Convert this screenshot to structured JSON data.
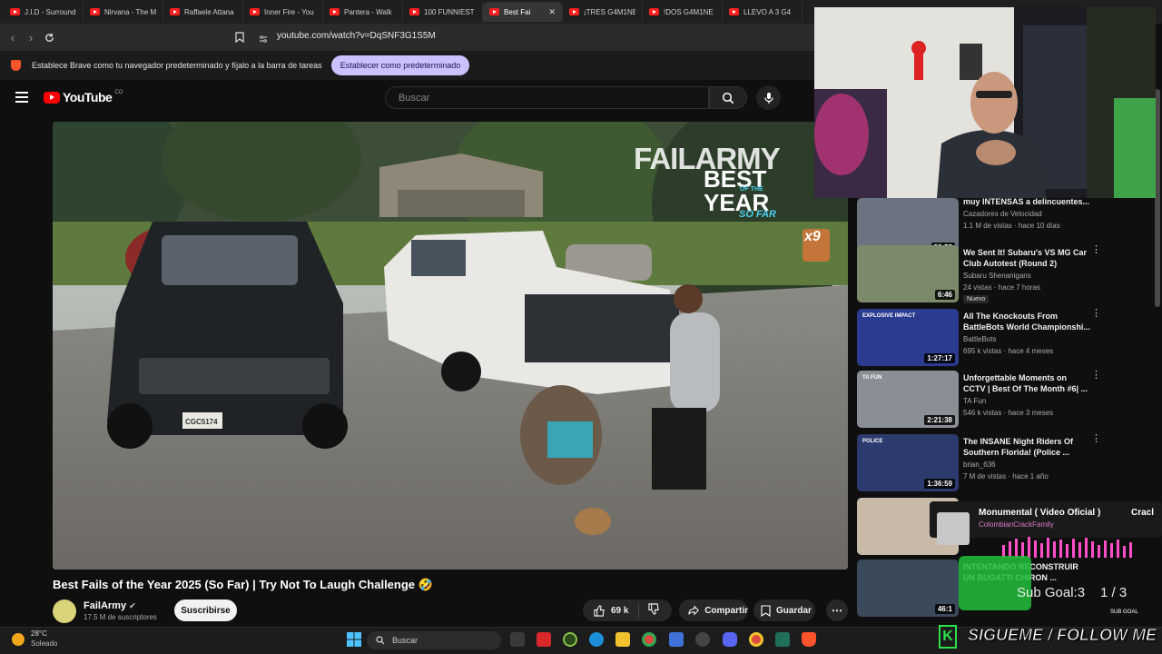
{
  "browser": {
    "tabs": [
      {
        "title": "J.I.D - Surround"
      },
      {
        "title": "Nirvana - The M"
      },
      {
        "title": "Raffaele Attana"
      },
      {
        "title": "Inner Fire - You"
      },
      {
        "title": "Pantera - Walk"
      },
      {
        "title": "100 FUNNIEST"
      },
      {
        "title": "Best Fai",
        "active": true
      },
      {
        "title": "¡TRES G4M1NE"
      },
      {
        "title": "!DOS G4M1NE"
      },
      {
        "title": "LLEVO A 3 G4"
      }
    ],
    "url": "youtube.com/watch?v=DqSNF3G1S5M",
    "banner_text": "Establece Brave como tu navegador predeterminado y fíjalo a la barra de tareas",
    "banner_button": "Establecer como predeterminado"
  },
  "youtube": {
    "logo": "YouTube",
    "country": "CO",
    "search_placeholder": "Buscar",
    "video": {
      "title": "Best Fails of the Year 2025 (So Far) | Try Not To Laugh Challenge 🤣",
      "watermark_brand": "FAILARMY",
      "watermark_best": "BEST",
      "watermark_of": "OF THE",
      "watermark_year": "YEAR",
      "watermark_sofar": "SO FAR",
      "multiplier": "x9",
      "plate": "CGC5174"
    },
    "channel": {
      "name": "FailArmy",
      "subscribers": "17.5 M de suscriptores",
      "subscribe": "Suscribirse"
    },
    "actions": {
      "likes": "69 k",
      "share": "Compartir",
      "save": "Guardar"
    },
    "sidebar": [
      {
        "title": "muy INTENSAS a delincuentes...",
        "channel": "Cazadores de Velocidad",
        "meta": "1.1 M de vistas · hace 10 días",
        "duration": "33:58",
        "thumb_color": "#6b7280"
      },
      {
        "title": "We Sent It! Subaru's VS MG Car Club Autotest (Round 2)",
        "channel": "Subaru Shenanigans",
        "meta": "24 vistas · hace 7 horas",
        "badge": "Nuevo",
        "duration": "6:46",
        "thumb_color": "#7a8a6a"
      },
      {
        "title": "All The Knockouts From BattleBots World Championshi...",
        "channel": "BattleBots",
        "meta": "695 k vistas · hace 4 meses",
        "duration": "1:27:17",
        "thumb_color": "#2b3b8f",
        "thumb_text": "EXPLOSIVE IMPACT"
      },
      {
        "title": "Unforgettable Moments on CCTV | Best Of The Month #6| ...",
        "channel": "TA Fun",
        "meta": "546 k vistas · hace 3 meses",
        "duration": "2:21:38",
        "thumb_color": "#8a8f96",
        "thumb_text": "TA FUN"
      },
      {
        "title": "The INSANE Night Riders Of Southern Florida! (Police ...",
        "channel": "brian_636",
        "meta": "7 M de vistas · hace 1 año",
        "duration": "1:36:59",
        "thumb_color": "#2d3a6e",
        "thumb_text": "POLICE"
      },
      {
        "title": "",
        "channel": "",
        "meta": "",
        "duration": "",
        "thumb_color": "#c9b9a8"
      },
      {
        "title": "INTENTANDO RECONSTRUIR UN BUGATTI CHIRON ...",
        "channel": "",
        "meta": "",
        "duration": "46:1",
        "thumb_color": "#3a4a5a"
      }
    ]
  },
  "overlay": {
    "song": "Monumental ( Video Oficial )",
    "song_extra": "Cracl",
    "artist": "ColombianCrackFamily",
    "sub_goal": "Sub Goal:3",
    "sub_count": "1 / 3",
    "sub_badge": "SUB GOAL",
    "follow": "SIGUEME / FOLLOW ME"
  },
  "taskbar": {
    "temperature": "28°C",
    "weather": "Soleado",
    "search": "Buscar"
  }
}
